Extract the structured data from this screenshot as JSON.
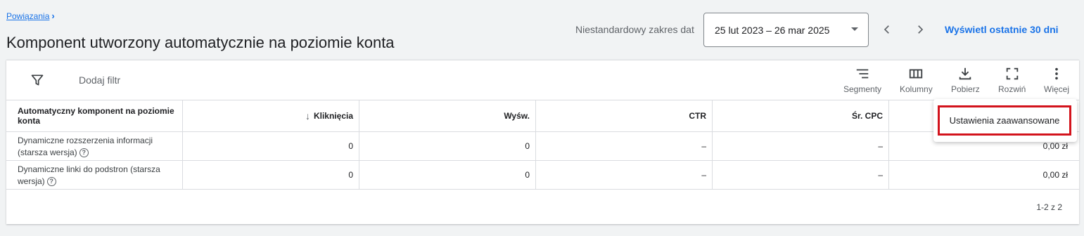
{
  "breadcrumb": {
    "link": "Powiązania",
    "chevron": "›"
  },
  "page_title": "Komponent utworzony automatycznie na poziomie konta",
  "date_range": {
    "label": "Niestandardowy zakres dat",
    "value": "25 lut 2023 – 26 mar 2025",
    "show_last_label": "Wyświetl ostatnie 30 dni"
  },
  "toolbar": {
    "add_filter": "Dodaj filtr",
    "segments": "Segmenty",
    "columns": "Kolumny",
    "download": "Pobierz",
    "expand": "Rozwiń",
    "more": "Więcej"
  },
  "table": {
    "headers": {
      "name": "Automatyczny komponent na poziomie konta",
      "clicks": "Kliknięcia",
      "impressions": "Wyśw.",
      "ctr": "CTR",
      "avg_cpc": "Śr. CPC",
      "cost": "",
      "sort_arrow": "↓"
    },
    "rows": [
      {
        "name": "Dynamiczne rozszerzenia informacji (starsza wersja)",
        "clicks": "0",
        "impressions": "0",
        "ctr": "–",
        "avg_cpc": "–",
        "cost": "0,00 zł"
      },
      {
        "name": "Dynamiczne linki do podstron (starsza wersja)",
        "clicks": "0",
        "impressions": "0",
        "ctr": "–",
        "avg_cpc": "–",
        "cost": "0,00 zł"
      }
    ],
    "help_glyph": "?",
    "pagination": "1-2 z 2"
  },
  "menu": {
    "item": "Ustawienia zaawansowane",
    "highlight_color": "#d3131c"
  },
  "colors": {
    "accent": "#1a73e8",
    "background": "#f1f3f4"
  }
}
